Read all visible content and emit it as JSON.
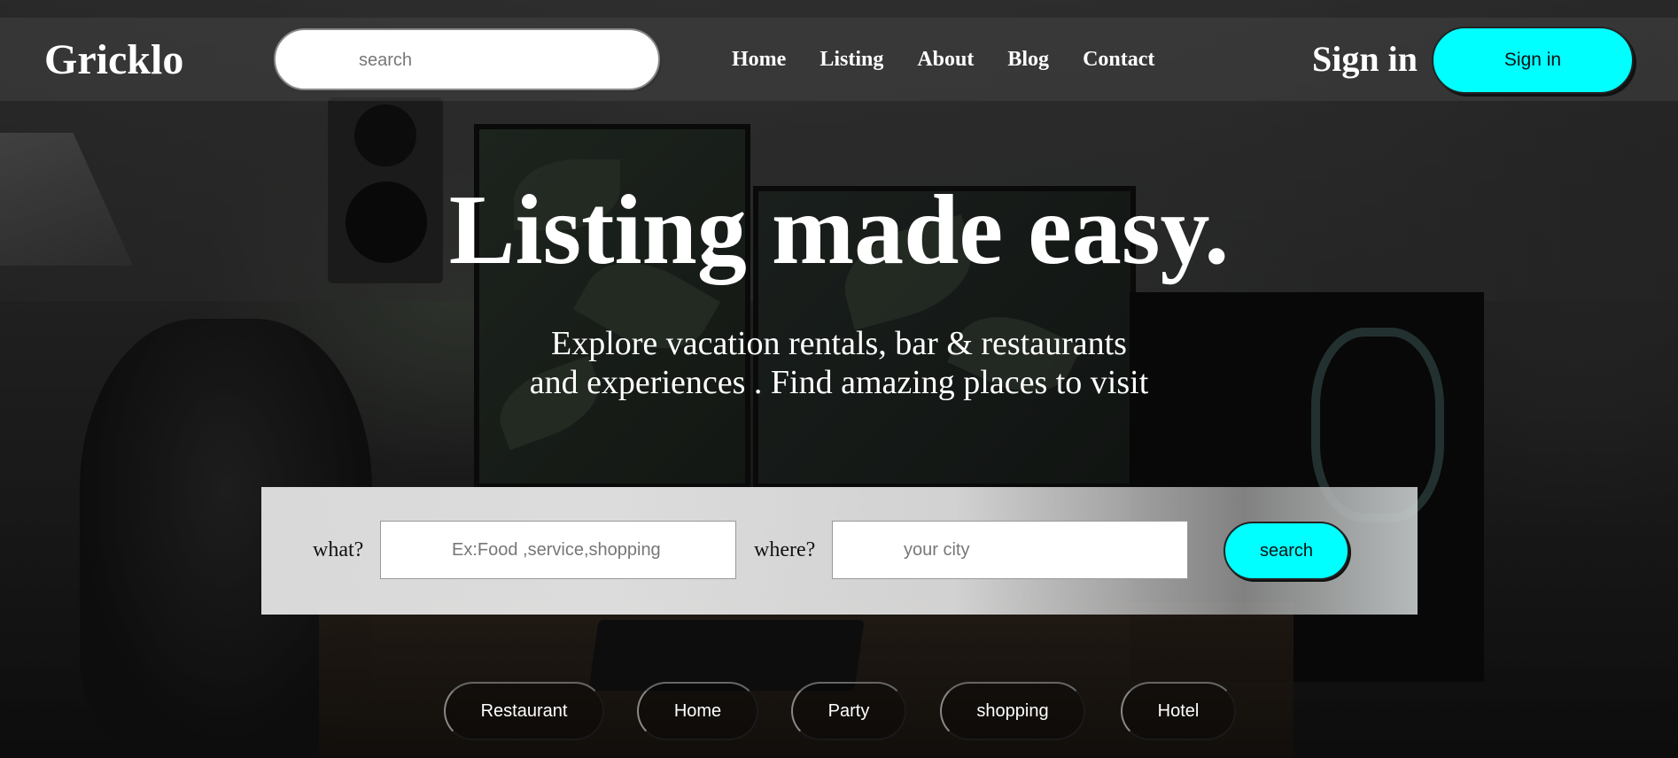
{
  "header": {
    "logo": "Gricklo",
    "search_placeholder": "search",
    "nav": [
      "Home",
      "Listing",
      "About",
      "Blog",
      "Contact"
    ],
    "signin_text": "Sign in",
    "signin_button": "Sign in"
  },
  "hero": {
    "title": "Listing made easy.",
    "subtitle_line1": "Explore vacation rentals, bar & restaurants",
    "subtitle_line2": "and experiences . Find amazing places to visit"
  },
  "search_panel": {
    "what_label": "what?",
    "what_placeholder": "Ex:Food ,service,shopping",
    "where_label": "where?",
    "where_placeholder": "your city",
    "button": "search"
  },
  "categories": [
    "Restaurant",
    "Home",
    "Party",
    "shopping",
    "Hotel"
  ],
  "colors": {
    "accent": "#00ffff"
  }
}
